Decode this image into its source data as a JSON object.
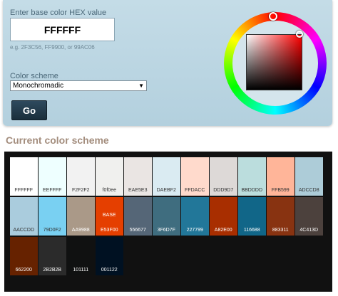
{
  "form": {
    "hex_label": "Enter base color HEX value",
    "hex_value": "FFFFFF",
    "hex_hint": "e.g. 2F3C56, FF9900, or 99AC06",
    "scheme_label": "Color scheme",
    "scheme_value": "Monochromadic",
    "go_label": "Go"
  },
  "picker": {
    "selected_hue": "#ff0000"
  },
  "section_title": "Current color scheme",
  "swatches": [
    {
      "hex": "FFFFFF",
      "color": "#ffffff",
      "text": "#333333"
    },
    {
      "hex": "EEFFFF",
      "color": "#eeffff",
      "text": "#333333"
    },
    {
      "hex": "F2F2F2",
      "color": "#f2f2f2",
      "text": "#333333"
    },
    {
      "hex": "f0f0ee",
      "color": "#f0f0ee",
      "text": "#333333"
    },
    {
      "hex": "EAE5E3",
      "color": "#eae5e3",
      "text": "#333333"
    },
    {
      "hex": "DAEBF2",
      "color": "#daebf2",
      "text": "#333333"
    },
    {
      "hex": "FFDACC",
      "color": "#ffdacc",
      "text": "#333333"
    },
    {
      "hex": "DDD9D7",
      "color": "#ddd9d7",
      "text": "#333333"
    },
    {
      "hex": "BBDDDD",
      "color": "#bbdddd",
      "text": "#333333"
    },
    {
      "hex": "FFB599",
      "color": "#ffb599",
      "text": "#333333"
    },
    {
      "hex": "ADCCD8",
      "color": "#adccd8",
      "text": "#333333"
    },
    {
      "hex": "AACCDD",
      "color": "#aaccdd",
      "text": "#333333"
    },
    {
      "hex": "79D0F2",
      "color": "#79d0f2",
      "text": "#333333"
    },
    {
      "hex": "AA9988",
      "color": "#aa9988",
      "text": "#ffffff"
    },
    {
      "hex": "E53F00",
      "color": "#e53f00",
      "text": "#ffffff",
      "base": "BASE"
    },
    {
      "hex": "556677",
      "color": "#556677",
      "text": "#ffffff"
    },
    {
      "hex": "3F6D7F",
      "color": "#3f6d7f",
      "text": "#ffffff"
    },
    {
      "hex": "227799",
      "color": "#227799",
      "text": "#ffffff"
    },
    {
      "hex": "A82E00",
      "color": "#a82e00",
      "text": "#ffffff"
    },
    {
      "hex": "116688",
      "color": "#116688",
      "text": "#ffffff"
    },
    {
      "hex": "883311",
      "color": "#883311",
      "text": "#ffffff"
    },
    {
      "hex": "4C413D",
      "color": "#4c413d",
      "text": "#ffffff"
    },
    {
      "hex": "662200",
      "color": "#662200",
      "text": "#ffffff"
    },
    {
      "hex": "2B2B2B",
      "color": "#2b2b2b",
      "text": "#ffffff"
    },
    {
      "hex": "101111",
      "color": "#101111",
      "text": "#ffffff"
    },
    {
      "hex": "001122",
      "color": "#001122",
      "text": "#ffffff"
    }
  ]
}
